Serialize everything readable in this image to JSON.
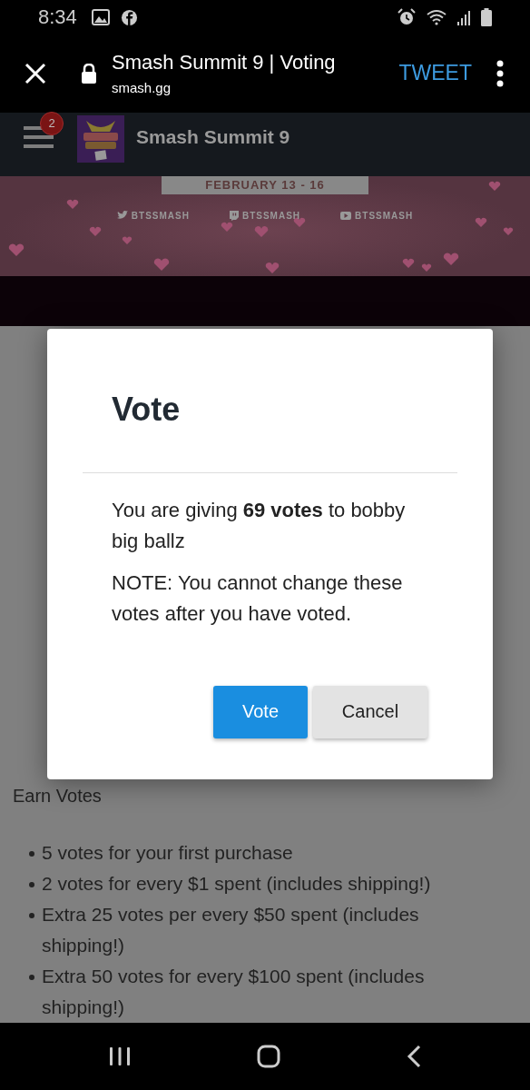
{
  "status_bar": {
    "time": "8:34"
  },
  "browser_bar": {
    "title": "Smash Summit 9 | Voting",
    "url": "smash.gg",
    "action": "TWEET"
  },
  "site_header": {
    "title": "Smash Summit 9",
    "notification_count": "2"
  },
  "banner": {
    "dates": "FEBRUARY 13 - 16",
    "socials": [
      {
        "kind": "twitter",
        "handle": "BTSSMASH"
      },
      {
        "kind": "twitch",
        "handle": "BTSSMASH"
      },
      {
        "kind": "youtube",
        "handle": "BTSSMASH"
      }
    ]
  },
  "dialog": {
    "title": "Vote",
    "message": "You are giving **69 votes** to bobby big ballz",
    "note": "NOTE: You cannot change these votes after you have voted.",
    "buttons": [
      {
        "label": "Vote",
        "kind": "primary"
      },
      {
        "label": "Cancel",
        "kind": "secondary"
      }
    ]
  },
  "earn_votes": {
    "heading": "Earn Votes",
    "items": [
      "5 votes for your first purchase",
      "2 votes for every $1 spent (includes shipping!)",
      "Extra 25 votes per every $50 spent (includes shipping!)",
      "Extra 50 votes for every $100 spent (includes shipping!)"
    ]
  }
}
